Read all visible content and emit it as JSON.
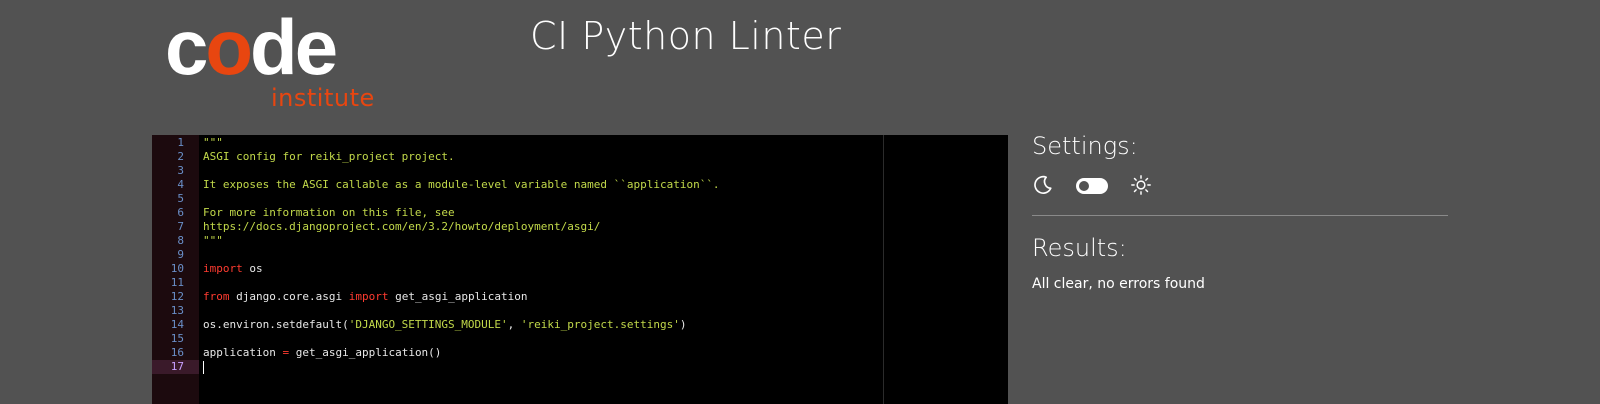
{
  "header": {
    "logo_word_start": "c",
    "logo_word_o": "o",
    "logo_word_end": "de",
    "logo_sub": "institute",
    "title": "CI Python Linter"
  },
  "colors": {
    "background": "#525252",
    "brand_orange": "#e84610",
    "keyword": "#ff3b30",
    "string": "#c2d94a",
    "line_number": "#6a8fc8"
  },
  "editor": {
    "lines": [
      {
        "n": "1",
        "parts": [
          {
            "t": "\"\"\"",
            "c": "doc"
          }
        ]
      },
      {
        "n": "2",
        "parts": [
          {
            "t": "ASGI config for reiki_project project.",
            "c": "doc"
          }
        ]
      },
      {
        "n": "3",
        "parts": []
      },
      {
        "n": "4",
        "parts": [
          {
            "t": "It exposes the ASGI callable as a module-level variable named ``application``.",
            "c": "doc"
          }
        ]
      },
      {
        "n": "5",
        "parts": []
      },
      {
        "n": "6",
        "parts": [
          {
            "t": "For more information on this file, see",
            "c": "doc"
          }
        ]
      },
      {
        "n": "7",
        "parts": [
          {
            "t": "https://docs.djangoproject.com/en/3.2/howto/deployment/asgi/",
            "c": "doc"
          }
        ]
      },
      {
        "n": "8",
        "parts": [
          {
            "t": "\"\"\"",
            "c": "doc"
          }
        ]
      },
      {
        "n": "9",
        "parts": []
      },
      {
        "n": "10",
        "parts": [
          {
            "t": "import",
            "c": "kw"
          },
          {
            "t": " os",
            "c": ""
          }
        ]
      },
      {
        "n": "11",
        "parts": []
      },
      {
        "n": "12",
        "parts": [
          {
            "t": "from",
            "c": "kw"
          },
          {
            "t": " django.core.asgi ",
            "c": ""
          },
          {
            "t": "import",
            "c": "kw"
          },
          {
            "t": " get_asgi_application",
            "c": ""
          }
        ]
      },
      {
        "n": "13",
        "parts": []
      },
      {
        "n": "14",
        "parts": [
          {
            "t": "os.environ.setdefault(",
            "c": ""
          },
          {
            "t": "'DJANGO_SETTINGS_MODULE'",
            "c": "str"
          },
          {
            "t": ", ",
            "c": ""
          },
          {
            "t": "'reiki_project.settings'",
            "c": "str"
          },
          {
            "t": ")",
            "c": ""
          }
        ]
      },
      {
        "n": "15",
        "parts": []
      },
      {
        "n": "16",
        "parts": [
          {
            "t": "application ",
            "c": ""
          },
          {
            "t": "=",
            "c": "kw"
          },
          {
            "t": " get_asgi_application()",
            "c": ""
          }
        ]
      },
      {
        "n": "17",
        "parts": [],
        "active": true
      }
    ]
  },
  "settings": {
    "title": "Settings:",
    "dark_icon": "moon-icon",
    "light_icon": "sun-icon",
    "theme_toggle_on": false
  },
  "results": {
    "title": "Results:",
    "message": "All clear, no errors found"
  }
}
